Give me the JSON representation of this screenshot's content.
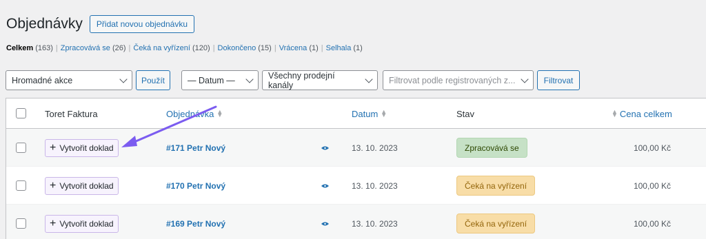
{
  "header": {
    "title": "Objednávky",
    "add_button": "Přidat novou objednávku"
  },
  "filters": [
    {
      "label": "Celkem",
      "count": "(163)",
      "current": true
    },
    {
      "label": "Zpracovává se",
      "count": "(26)"
    },
    {
      "label": "Čeká na vyřízení",
      "count": "(120)"
    },
    {
      "label": "Dokončeno",
      "count": "(15)"
    },
    {
      "label": "Vrácena",
      "count": "(1)"
    },
    {
      "label": "Selhala",
      "count": "(1)"
    }
  ],
  "toolbar": {
    "bulk_actions": "Hromadné akce",
    "apply": "Použít",
    "date": "— Datum —",
    "channels": "Všechny prodejní kanály",
    "customer_placeholder": "Filtrovat podle registrovaných z...",
    "filter": "Filtrovat"
  },
  "columns": {
    "toret": "Toret Faktura",
    "order": "Objednávka",
    "date": "Datum",
    "status": "Stav",
    "total": "Cena celkem"
  },
  "rows": [
    {
      "action": "Vytvořit doklad",
      "order": "#171 Petr Nový",
      "date": "13. 10. 2023",
      "status": "Zpracovává se",
      "status_type": "processing",
      "total": "100,00 Kč"
    },
    {
      "action": "Vytvořit doklad",
      "order": "#170 Petr Nový",
      "date": "13. 10. 2023",
      "status": "Čeká na vyřízení",
      "status_type": "onhold",
      "total": "100,00 Kč"
    },
    {
      "action": "Vytvořit doklad",
      "order": "#169 Petr Nový",
      "date": "13. 10. 2023",
      "status": "Čeká na vyřízení",
      "status_type": "onhold",
      "total": "100,00 Kč"
    }
  ],
  "colors": {
    "link": "#2271b1",
    "annotation_arrow": "#7b5cf0",
    "processing_bg": "#c6e1c6",
    "onhold_bg": "#f8dda7"
  },
  "icons": {
    "eye": "eye-icon",
    "plus": "plus-icon",
    "sort": "sort-icon",
    "chevron": "chevron-down-icon"
  }
}
